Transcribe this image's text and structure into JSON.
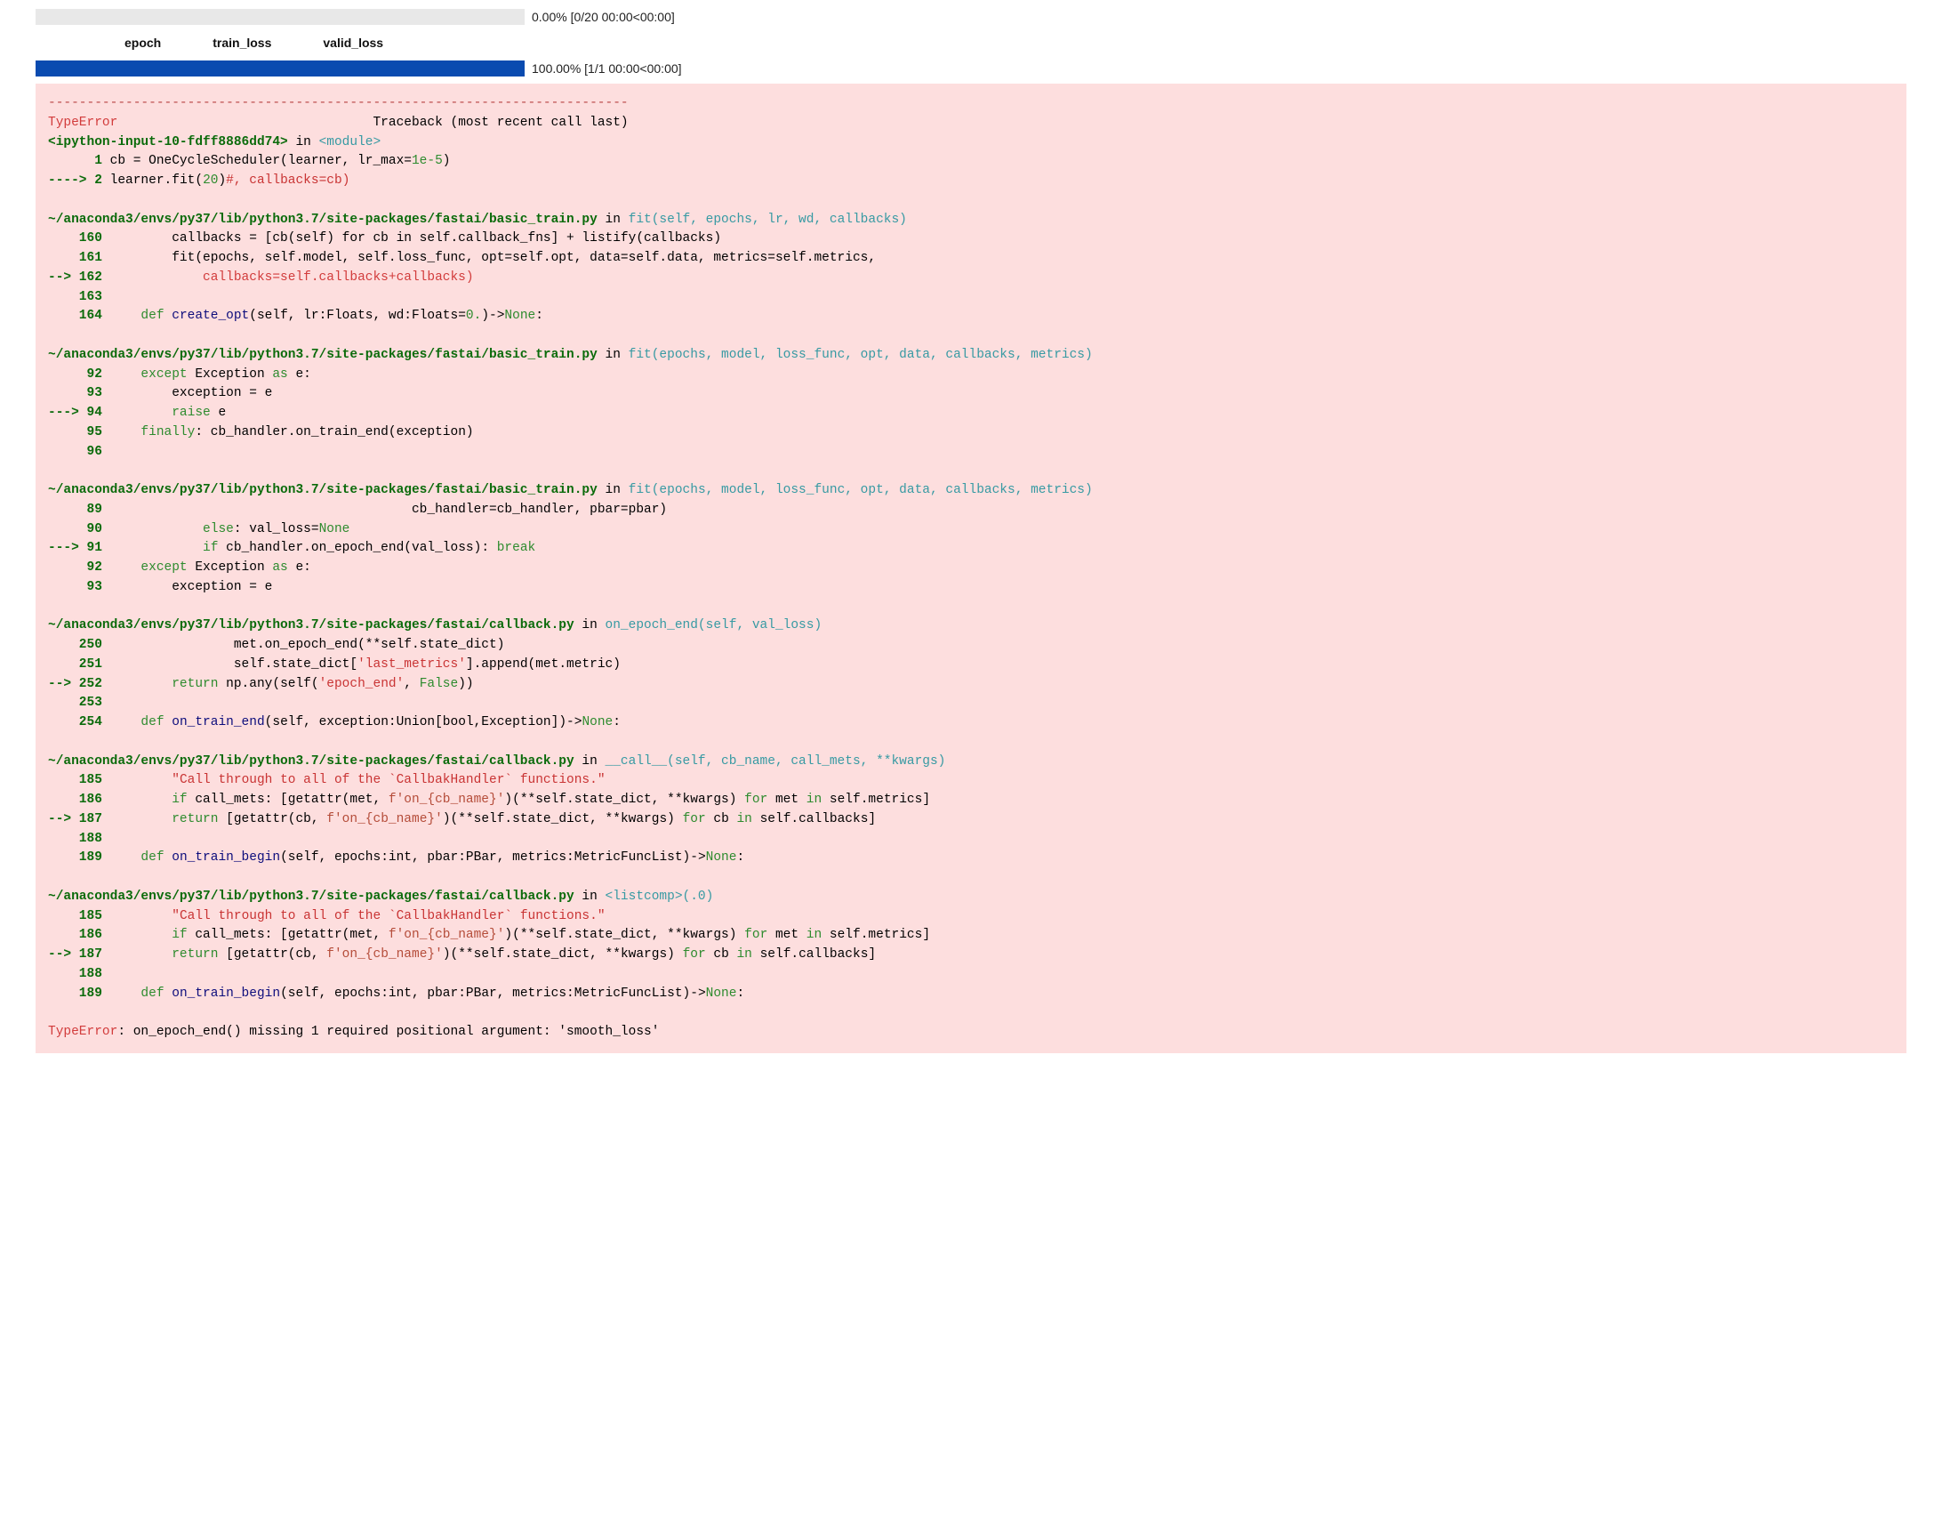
{
  "progress1": {
    "text": "0.00% [0/20 00:00<00:00]"
  },
  "tableHeaders": {
    "c1": "epoch",
    "c2": "train_loss",
    "c3": "valid_loss"
  },
  "progress2": {
    "text": "100.00% [1/1 00:00<00:00]"
  },
  "tb": {
    "sep": "---------------------------------------------------------------------------",
    "errName": "TypeError",
    "tbLabel": "Traceback (most recent call last)",
    "inputLoc": "<ipython-input-10-fdff8886dd74>",
    "inWord": " in ",
    "moduleTag": "<module>",
    "line1_no": "      1",
    "line1_code": " cb = OneCycleScheduler(learner, lr_max=",
    "line1_val": "1e-5",
    "line1_end": ")",
    "line2_arrow": "----> 2",
    "line2_a": " learner",
    "line2_b": ".fit(",
    "line2_c": "20",
    "line2_d": ")",
    "line2_e": "#, callbacks=cb)",
    "f1_path": "~/anaconda3/envs/py37/lib/python3.7/site-packages/fastai/basic_train.py",
    "f1_sig": "fit(self, epochs, lr, wd, callbacks)",
    "f1_l160_no": "    160",
    "f1_l160": "         callbacks = [cb(self) for cb in self.callback_fns] + listify(callbacks)",
    "f1_l161_no": "    161",
    "f1_l161": "         fit(epochs, self.model, self.loss_func, opt=self.opt, data=self.data, metrics=self.metrics,",
    "f1_l162_arrow": "--> 162",
    "f1_l162": "             callbacks=self.callbacks+callbacks)",
    "f1_l163_no": "    163",
    "f1_l164_no": "    164",
    "f1_l164_def": "     def",
    "f1_l164_name": " create_opt",
    "f1_l164_rest1": "(self, lr:Floats, wd:Floats=",
    "f1_l164_zero": "0.",
    "f1_l164_rest2": ")->",
    "f1_l164_none": "None",
    "f1_l164_colon": ":",
    "f2_path": "~/anaconda3/envs/py37/lib/python3.7/site-packages/fastai/basic_train.py",
    "f2_sig": "fit(epochs, model, loss_func, opt, data, callbacks, metrics)",
    "f2_l92_no": "     92",
    "f2_l92_a": "     except",
    "f2_l92_b": " Exception ",
    "f2_l92_c": "as",
    "f2_l92_d": " e",
    "f2_l92_e": ":",
    "f2_l93_no": "     93",
    "f2_l93": "         exception = e",
    "f2_l94_arrow": "---> 94",
    "f2_l94_a": "         raise",
    "f2_l94_b": " e",
    "f2_l95_no": "     95",
    "f2_l95_a": "     finally",
    "f2_l95_b": ": cb_handler",
    "f2_l95_c": ".on_train_end(",
    "f2_l95_d": "exception",
    "f2_l95_e": ")",
    "f2_l96_no": "     96",
    "f3_path": "~/anaconda3/envs/py37/lib/python3.7/site-packages/fastai/basic_train.py",
    "f3_sig": "fit(epochs, model, loss_func, opt, data, callbacks, metrics)",
    "f3_l89_no": "     89",
    "f3_l89": "                                        cb_handler=cb_handler, pbar=pbar)",
    "f3_l90_no": "     90",
    "f3_l90_a": "             else",
    "f3_l90_b": ": val_loss",
    "f3_l90_c": "=",
    "f3_l90_d": "None",
    "f3_l91_arrow": "---> 91",
    "f3_l91_a": "             if",
    "f3_l91_b": " cb_handler",
    "f3_l91_c": ".on_epoch_end(",
    "f3_l91_d": "val_loss",
    "f3_l91_e": "): ",
    "f3_l91_f": "break",
    "f3_l92_no": "     92",
    "f3_l93_no": "     93",
    "f3_l93": "         exception = e",
    "f4_path": "~/anaconda3/envs/py37/lib/python3.7/site-packages/fastai/callback.py",
    "f4_sig": "on_epoch_end(self, val_loss)",
    "f4_l250_no": "    250",
    "f4_l250": "                 met.on_epoch_end(**self.state_dict)",
    "f4_l251_no": "    251",
    "f4_l251_a": "                 self.state_dict[",
    "f4_l251_b": "'last_metrics'",
    "f4_l251_c": "].append(met.metric)",
    "f4_l252_arrow": "--> 252",
    "f4_l252_a": "         return",
    "f4_l252_b": " np.any(self(",
    "f4_l252_c": "'epoch_end'",
    "f4_l252_d": ", ",
    "f4_l252_e": "False",
    "f4_l252_f": "))",
    "f4_l253_no": "    253",
    "f4_l254_no": "    254",
    "f4_l254_a": "     def",
    "f4_l254_b": " on_train_end",
    "f4_l254_c": "(self, exception:Union[bool,Exception])->",
    "f4_l254_d": "None",
    "f4_l254_e": ":",
    "f5_path": "~/anaconda3/envs/py37/lib/python3.7/site-packages/fastai/callback.py",
    "f5_sig": "__call__(self, cb_name, call_mets, **kwargs)",
    "f5_l185_no": "    185",
    "f5_l185_a": "         ",
    "f5_l185_b": "\"Call through to all of the `CallbakHandler` functions.\"",
    "f5_l186_no": "    186",
    "f5_l186_a": "         if",
    "f5_l186_b": " call_mets: [getattr(met, ",
    "f5_l186_c": "f'on_{cb_name}'",
    "f5_l186_d": ")(**self.state_dict, **kwargs) ",
    "f5_l186_e": "for",
    "f5_l186_f": " met ",
    "f5_l186_g": "in",
    "f5_l186_h": " self.metrics]",
    "f5_l187_arrow": "--> 187",
    "f5_l187_a": "         return",
    "f5_l187_b": " [getattr(cb, ",
    "f5_l187_c": "f'on_{cb_name}'",
    "f5_l187_d": ")(**self.state_dict, **kwargs) ",
    "f5_l187_e": "for",
    "f5_l187_f": " cb ",
    "f5_l187_g": "in",
    "f5_l187_h": " self.callbacks]",
    "f5_l188_no": "    188",
    "f5_l189_no": "    189",
    "f5_l189_a": "     def",
    "f5_l189_b": " on_train_begin",
    "f5_l189_c": "(self, epochs:int, pbar:PBar, metrics:MetricFuncList)->",
    "f5_l189_d": "None",
    "f5_l189_e": ":",
    "f6_path": "~/anaconda3/envs/py37/lib/python3.7/site-packages/fastai/callback.py",
    "f6_sig": "<listcomp>(.0)",
    "errFinalName": "TypeError",
    "errFinalMsg": ": on_epoch_end() missing 1 required positional argument: 'smooth_loss'"
  }
}
